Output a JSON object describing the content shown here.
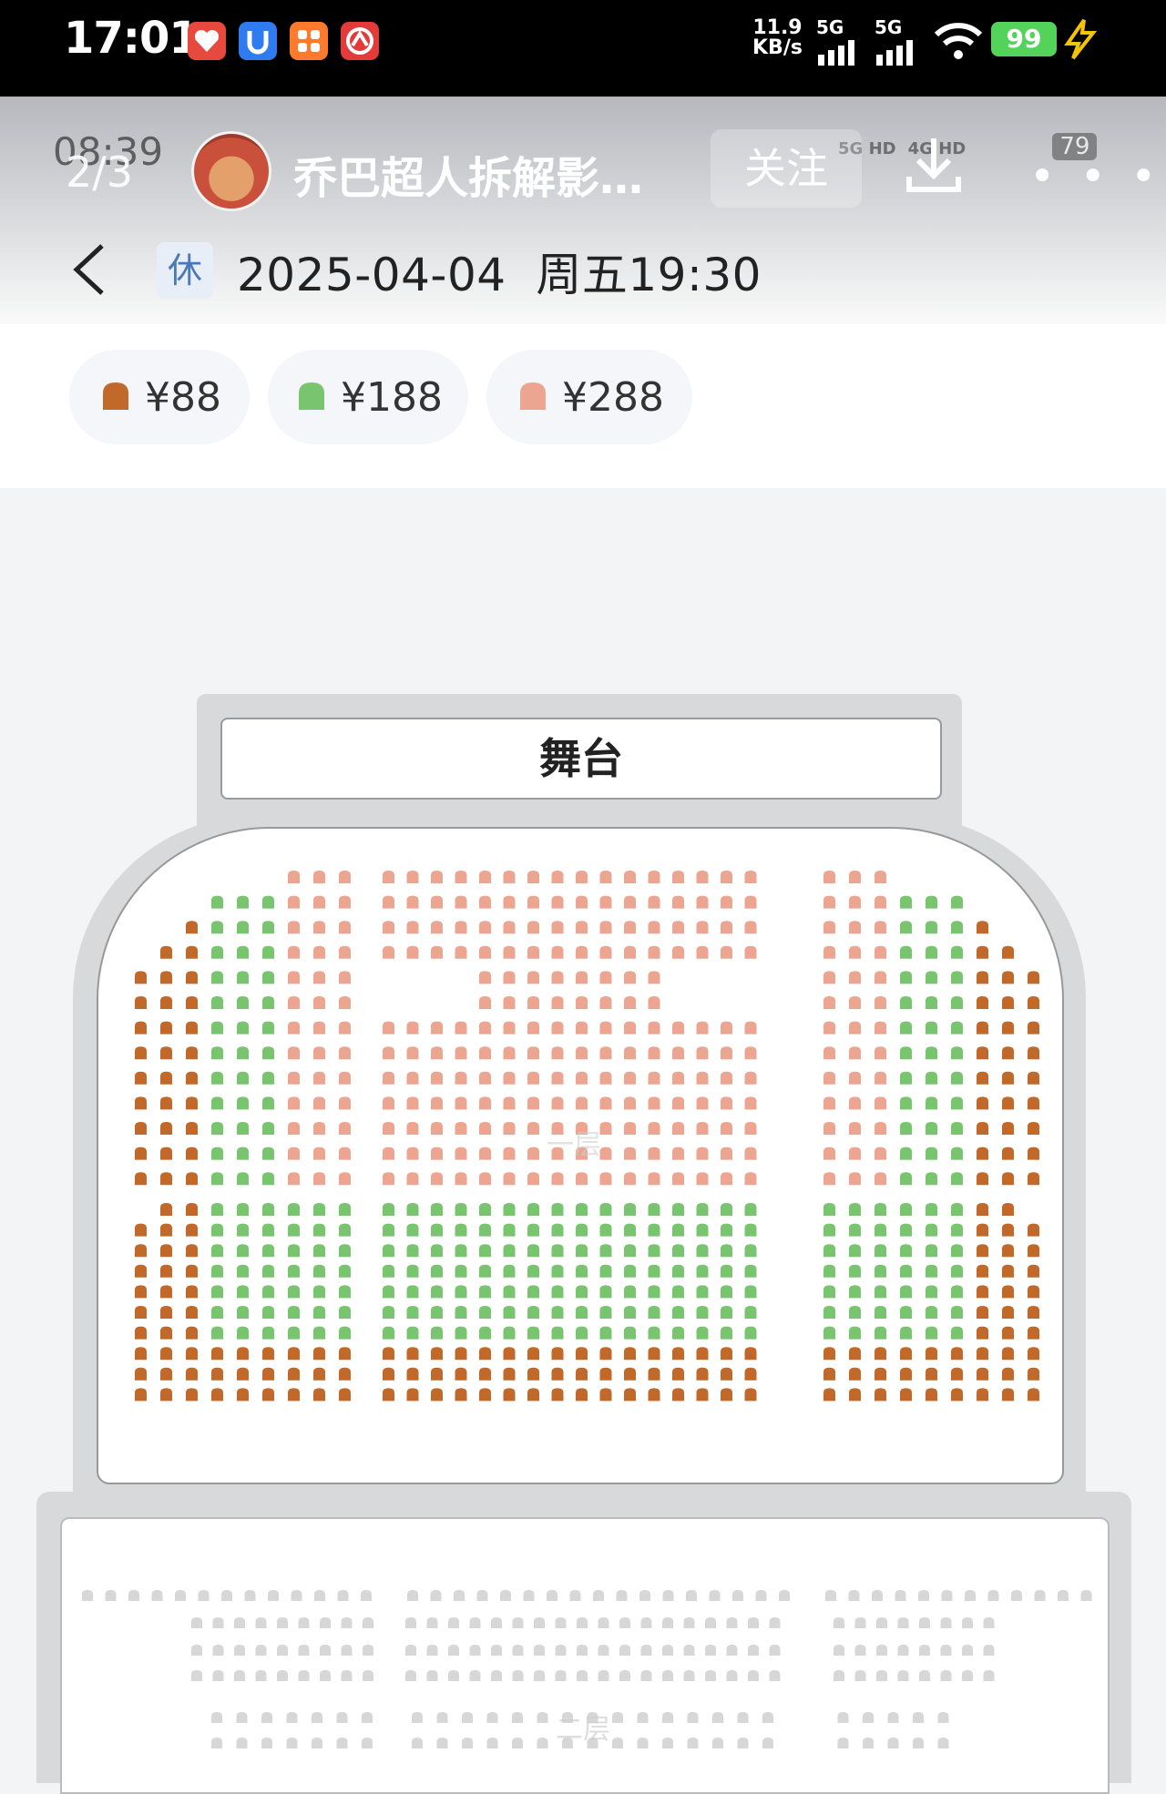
{
  "status_bar": {
    "time": "17:01",
    "net_speed_value": "11.9",
    "net_speed_unit": "KB/s",
    "signal1_label": "5G",
    "signal2_label": "5G",
    "battery": "99",
    "icons": [
      "app-red-heart-icon",
      "app-blue-shield-icon",
      "app-orange-grid-icon",
      "app-red-bank-icon",
      "wifi-icon",
      "charging-bolt-icon"
    ]
  },
  "viewer": {
    "inner_time": "08:39",
    "page_indicator": "2/3",
    "uploader_name": "乔巴超人拆解影…",
    "follow_label": "关注",
    "more_label": "• • •",
    "inner_battery": "79",
    "inner_signal_a": "5G HD",
    "inner_signal_b": "4G HD"
  },
  "nav": {
    "holiday_badge": "休",
    "date": "2025-04-04",
    "weekday_time": "周五19:30"
  },
  "price_legend": [
    {
      "label": "¥88",
      "color": "#c0692a"
    },
    {
      "label": "¥188",
      "color": "#79c56f"
    },
    {
      "label": "¥288",
      "color": "#eba591"
    }
  ],
  "seat_map": {
    "stage_label": "舞台",
    "floor1_label": "一层",
    "floor2_label": "二层",
    "seat_colors": {
      "88": "#c0692a",
      "188": "#79c56f",
      "288": "#eba591",
      "unavailable": "#d7d7d7"
    }
  }
}
